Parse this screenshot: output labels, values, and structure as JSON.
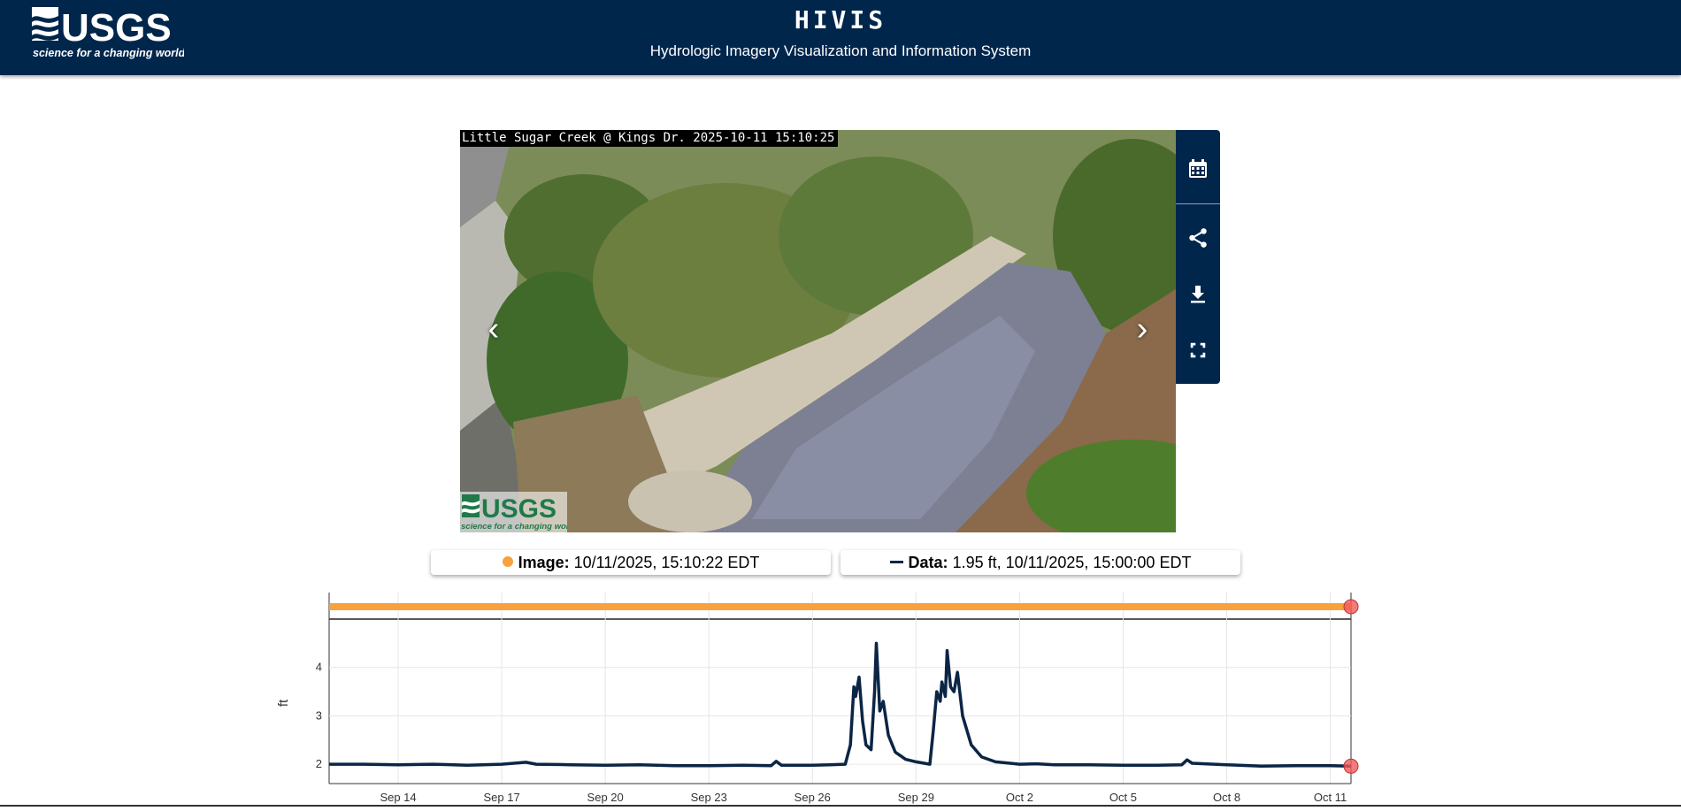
{
  "header": {
    "logo_name": "USGS",
    "logo_tagline": "science for a changing world",
    "title": "HIVIS",
    "subtitle": "Hydrologic Imagery Visualization and Information System"
  },
  "camera": {
    "overlay_text": "Little Sugar Creek @ Kings Dr. 2025-10-11 15:10:25",
    "watermark_name": "USGS",
    "watermark_tagline": "science for a changing world",
    "prev_label": "‹",
    "next_label": "›"
  },
  "toolbar": {
    "buttons": [
      {
        "icon": "calendar-icon"
      },
      {
        "icon": "share-icon"
      },
      {
        "icon": "download-icon"
      },
      {
        "icon": "fullscreen-icon"
      }
    ]
  },
  "info": {
    "image_label": "Image:",
    "image_value": "10/11/2025, 15:10:22 EDT",
    "data_label": "Data:",
    "data_value": "1.95 ft, 10/11/2025, 15:00:00 EDT"
  },
  "colors": {
    "header_bg": "#00264c",
    "series_line": "#0b2545",
    "image_bar": "#f7a23c",
    "marker": "#f05a5a"
  },
  "chart_data": {
    "type": "line",
    "ylabel": "ft",
    "yticks": [
      2,
      3,
      4
    ],
    "ylim": [
      1.6,
      5.0
    ],
    "xticks": [
      "Sep 14",
      "Sep 17",
      "Sep 20",
      "Sep 23",
      "Sep 26",
      "Sep 29",
      "Oct 2",
      "Oct 5",
      "Oct 8",
      "Oct 11"
    ],
    "xlim_days": [
      0,
      29.6
    ],
    "xtick_days": [
      2,
      5,
      8,
      11,
      14,
      17,
      20,
      23,
      26,
      29
    ],
    "grid": true,
    "image_availability": {
      "color": "#f7a23c",
      "start_day": 0,
      "end_day": 29.6
    },
    "series": [
      {
        "values": [
          [
            0,
            2.0
          ],
          [
            1,
            2.0
          ],
          [
            2,
            1.99
          ],
          [
            3,
            2.0
          ],
          [
            4,
            1.98
          ],
          [
            5,
            2.0
          ],
          [
            5.7,
            2.04
          ],
          [
            6,
            2.0
          ],
          [
            7,
            1.99
          ],
          [
            8,
            1.98
          ],
          [
            9,
            1.99
          ],
          [
            10,
            1.97
          ],
          [
            11,
            1.97
          ],
          [
            12,
            1.98
          ],
          [
            12.8,
            1.97
          ],
          [
            12.95,
            2.06
          ],
          [
            13.1,
            1.98
          ],
          [
            14,
            1.98
          ],
          [
            14.5,
            1.99
          ],
          [
            14.95,
            2.0
          ],
          [
            15.1,
            2.4
          ],
          [
            15.2,
            3.6
          ],
          [
            15.25,
            3.4
          ],
          [
            15.35,
            3.8
          ],
          [
            15.45,
            2.9
          ],
          [
            15.55,
            2.4
          ],
          [
            15.7,
            2.3
          ],
          [
            15.8,
            3.5
          ],
          [
            15.85,
            4.5
          ],
          [
            15.95,
            3.1
          ],
          [
            16.05,
            3.3
          ],
          [
            16.2,
            2.6
          ],
          [
            16.4,
            2.25
          ],
          [
            16.7,
            2.1
          ],
          [
            17.0,
            2.05
          ],
          [
            17.4,
            2.0
          ],
          [
            17.5,
            2.7
          ],
          [
            17.6,
            3.5
          ],
          [
            17.7,
            3.3
          ],
          [
            17.75,
            3.7
          ],
          [
            17.85,
            3.4
          ],
          [
            17.9,
            4.35
          ],
          [
            18.0,
            3.6
          ],
          [
            18.1,
            3.5
          ],
          [
            18.2,
            3.9
          ],
          [
            18.35,
            3.0
          ],
          [
            18.6,
            2.4
          ],
          [
            18.9,
            2.15
          ],
          [
            19.3,
            2.05
          ],
          [
            20,
            2.0
          ],
          [
            20.5,
            2.01
          ],
          [
            21,
            1.99
          ],
          [
            22,
            1.99
          ],
          [
            23,
            1.98
          ],
          [
            24,
            1.98
          ],
          [
            24.7,
            1.99
          ],
          [
            24.85,
            2.09
          ],
          [
            25.0,
            2.02
          ],
          [
            26,
            1.99
          ],
          [
            27,
            1.96
          ],
          [
            28,
            1.97
          ],
          [
            29,
            1.97
          ],
          [
            29.6,
            1.96
          ]
        ]
      }
    ]
  }
}
